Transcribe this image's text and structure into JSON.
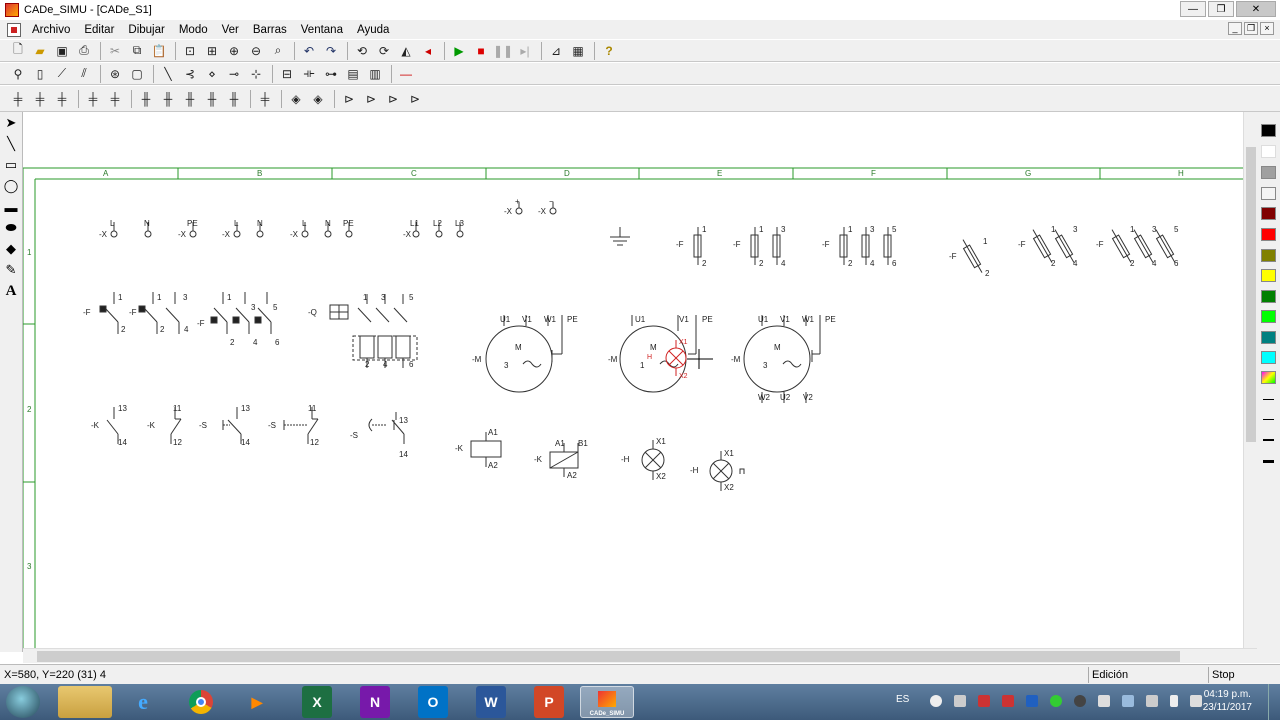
{
  "window": {
    "title": "CADe_SIMU - [CADe_S1]"
  },
  "menu": [
    "Archivo",
    "Editar",
    "Dibujar",
    "Modo",
    "Ver",
    "Barras",
    "Ventana",
    "Ayuda"
  ],
  "toolbar1": [
    "new-icon",
    "open-icon",
    "save-icon",
    "print-icon",
    "cut-icon",
    "copy-icon",
    "paste-icon",
    "print-preview-icon",
    "zoom-fit-icon",
    "zoom-in-icon",
    "zoom-out-icon",
    "zoom-window-icon",
    "undo-icon",
    "redo-icon",
    "rotate-left-icon",
    "rotate-right-icon",
    "mirror-icon",
    "flip-icon",
    "play-icon",
    "stop-icon",
    "pause-icon",
    "step-icon",
    "chart-icon",
    "layout-icon",
    "help-icon"
  ],
  "canvas": {
    "columns": [
      "A",
      "B",
      "C",
      "D",
      "E",
      "F",
      "G",
      "H"
    ],
    "rows": [
      "1",
      "2",
      "3"
    ],
    "labels": {
      "x1": "-X",
      "l": "L",
      "n": "N",
      "pe": "PE",
      "l1": "L1",
      "l2": "L2",
      "l3": "L3",
      "plus": "+",
      "minus": "−",
      "f": "-F",
      "q": "-Q",
      "m": "-M",
      "k": "-K",
      "s": "-S",
      "h": "-H",
      "u1": "U1",
      "v1": "V1",
      "w1": "W1",
      "u2": "U2",
      "v2": "V2",
      "w2": "W2",
      "motor": "M",
      "phase3": "3",
      "phase1": "1",
      "t1": "1",
      "t2": "2",
      "t3": "3",
      "t4": "4",
      "t5": "5",
      "t6": "6",
      "t11": "11",
      "t12": "12",
      "t13": "13",
      "t14": "14",
      "a1": "A1",
      "a2": "A2",
      "b1": "B1",
      "x1t": "X1",
      "x2t": "X2",
      "hsub": "H"
    }
  },
  "status": {
    "coords": "X=580, Y=220 (31) 4",
    "mode": "Edición",
    "sim": "Stop"
  },
  "taskbar": {
    "apps": [
      {
        "name": "explorer",
        "label": ""
      },
      {
        "name": "ie",
        "label": "e"
      },
      {
        "name": "chrome",
        "label": ""
      },
      {
        "name": "media",
        "label": "▶"
      },
      {
        "name": "excel",
        "label": "X"
      },
      {
        "name": "onenote",
        "label": "N"
      },
      {
        "name": "outlook",
        "label": "O"
      },
      {
        "name": "word",
        "label": "W"
      },
      {
        "name": "powerpoint",
        "label": "P"
      },
      {
        "name": "cadesimu",
        "label": "CADe_SIMU"
      }
    ],
    "lang": "ES",
    "time": "04:19 p.m.",
    "date": "23/11/2017"
  },
  "palette_colors": [
    "#000000",
    "#ffffff",
    "#808080",
    "#c0c0c0",
    "#800000",
    "#ff0000",
    "#808000",
    "#ffff00",
    "#008000",
    "#00ff00",
    "#008080",
    "#00ffff"
  ]
}
